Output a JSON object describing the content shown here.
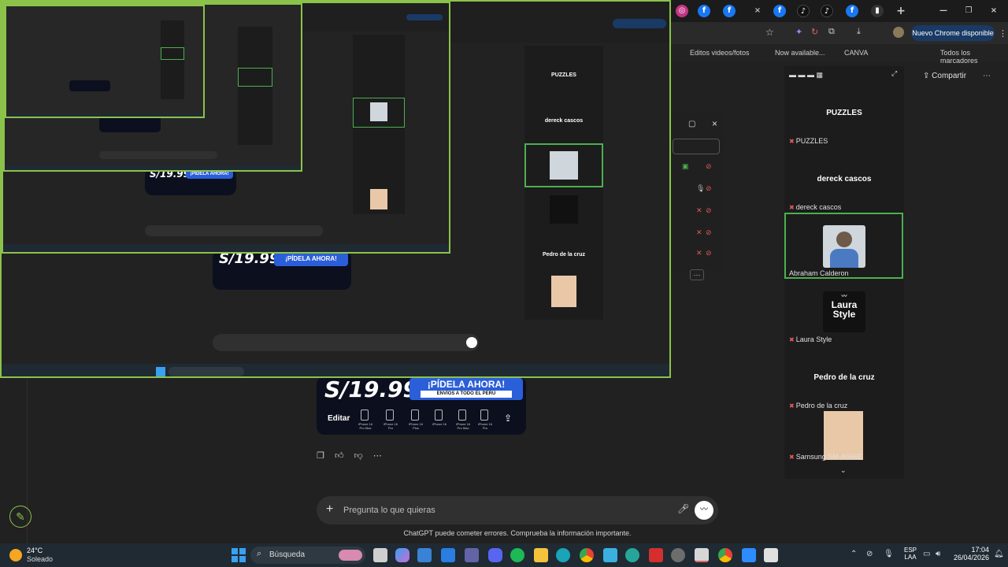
{
  "chrome": {
    "new_chrome_available": "Nuevo Chrome disponible",
    "bookmarks": [
      "Editos videos/fotos",
      "Now available...",
      "CANVA"
    ],
    "all_bookmarks": "Todos los marcadores"
  },
  "meet": {
    "share": "Compartir",
    "pinned": [
      {
        "section": "PUZZLES",
        "name": "PUZZLES"
      },
      {
        "section": "dereck cascos",
        "name": "dereck cascos"
      },
      {
        "section": "",
        "name": "Abraham Calderon"
      },
      {
        "section": "",
        "name": "Laura Style"
      },
      {
        "section": "Pedro de la cruz",
        "name": "Pedro de la cruz"
      },
      {
        "section": "",
        "name": "Samsung SM-A566E"
      }
    ],
    "logo_lines": [
      "Laura",
      "Style"
    ]
  },
  "chatgpt": {
    "promo_price": "S/19.99",
    "promo_banner_title": "¡PÍDELA AHORA!",
    "promo_banner_sub": "ENVÍOS A TODO EL PERÚ",
    "promo_edit": "Editar",
    "promo_models": [
      "iPhone 16 Pro Max",
      "iPhone 16 Pro",
      "iPhone 16 Plus",
      "iPhone 16",
      "iPhone 16 Pro Max",
      "iPhone 16 Pro"
    ],
    "input_placeholder": "Pregunta lo que quieras",
    "disclaimer": "ChatGPT puede cometer errores. Comprueba la información importante."
  },
  "taskbar": {
    "weather_temp": "24°C",
    "weather_desc": "Soleado",
    "search": "Búsqueda",
    "lang": "ESP",
    "lang2": "LAA",
    "time": "17:04",
    "date": "26/04/2026"
  },
  "colors": {
    "highlight": "#4caf50",
    "chrome_pill": "#1a3a66",
    "taskbar": "#202a33"
  }
}
